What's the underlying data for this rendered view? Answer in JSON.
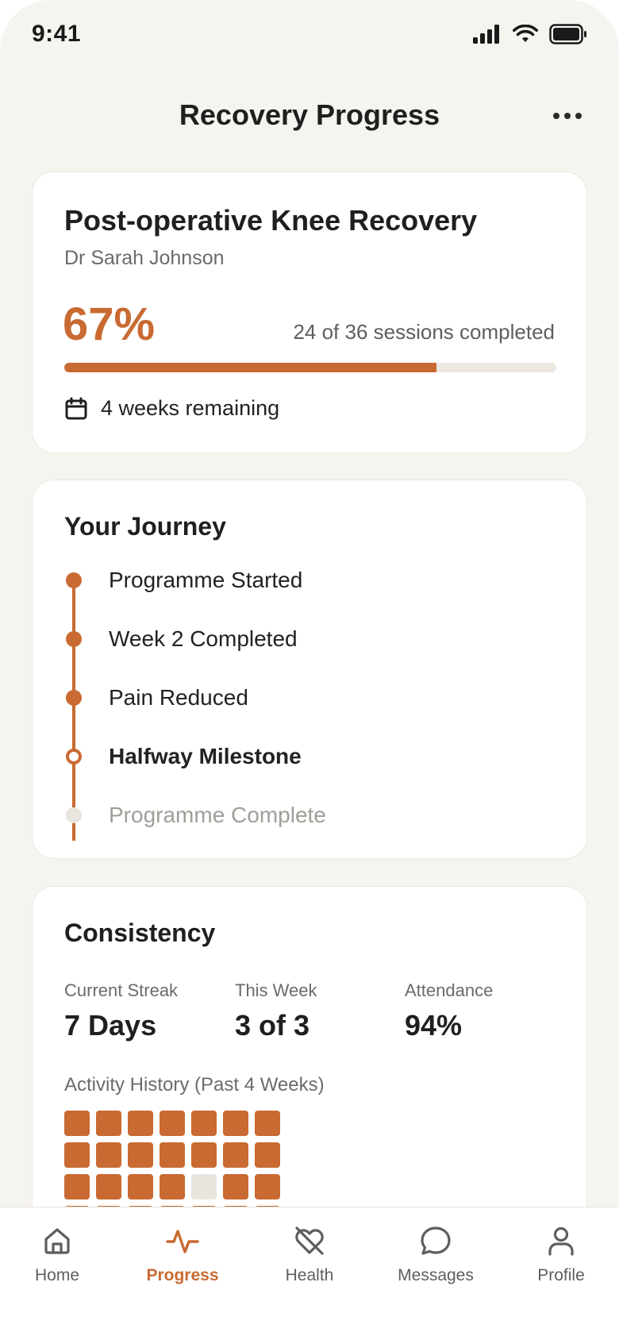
{
  "status": {
    "time": "9:41"
  },
  "header": {
    "title": "Recovery Progress"
  },
  "program": {
    "title": "Post-operative Knee Recovery",
    "doctor": "Dr Sarah Johnson",
    "percent_label": "67%",
    "progress_fraction": 0.757,
    "sessions_text": "24 of 36 sessions completed",
    "remaining_text": "4 weeks remaining"
  },
  "journey": {
    "heading": "Your Journey",
    "milestones": [
      {
        "label": "Programme Started",
        "state": "done"
      },
      {
        "label": "Week 2 Completed",
        "state": "done"
      },
      {
        "label": "Pain Reduced",
        "state": "done"
      },
      {
        "label": "Halfway Milestone",
        "state": "current"
      },
      {
        "label": "Programme Complete",
        "state": "pending"
      }
    ]
  },
  "consistency": {
    "heading": "Consistency",
    "stats": [
      {
        "label": "Current Streak",
        "value": "7 Days"
      },
      {
        "label": "This Week",
        "value": "3 of 3"
      },
      {
        "label": "Attendance",
        "value": "94%"
      }
    ],
    "history_label": "Activity History (Past 4 Weeks)",
    "activity": [
      [
        1,
        1,
        1,
        1,
        1,
        1,
        1
      ],
      [
        1,
        1,
        1,
        1,
        1,
        1,
        1
      ],
      [
        1,
        1,
        1,
        1,
        0,
        1,
        1
      ],
      [
        1,
        1,
        1,
        1,
        1,
        1,
        1
      ]
    ]
  },
  "nav": {
    "items": [
      {
        "label": "Home",
        "icon": "home-icon"
      },
      {
        "label": "Progress",
        "icon": "activity-icon",
        "active": true
      },
      {
        "label": "Health",
        "icon": "heart-off-icon"
      },
      {
        "label": "Messages",
        "icon": "message-icon"
      },
      {
        "label": "Profile",
        "icon": "user-icon"
      }
    ]
  },
  "colors": {
    "accent": "#C96A32",
    "background": "#F6F4EF",
    "muted": "#E8E5DF"
  }
}
